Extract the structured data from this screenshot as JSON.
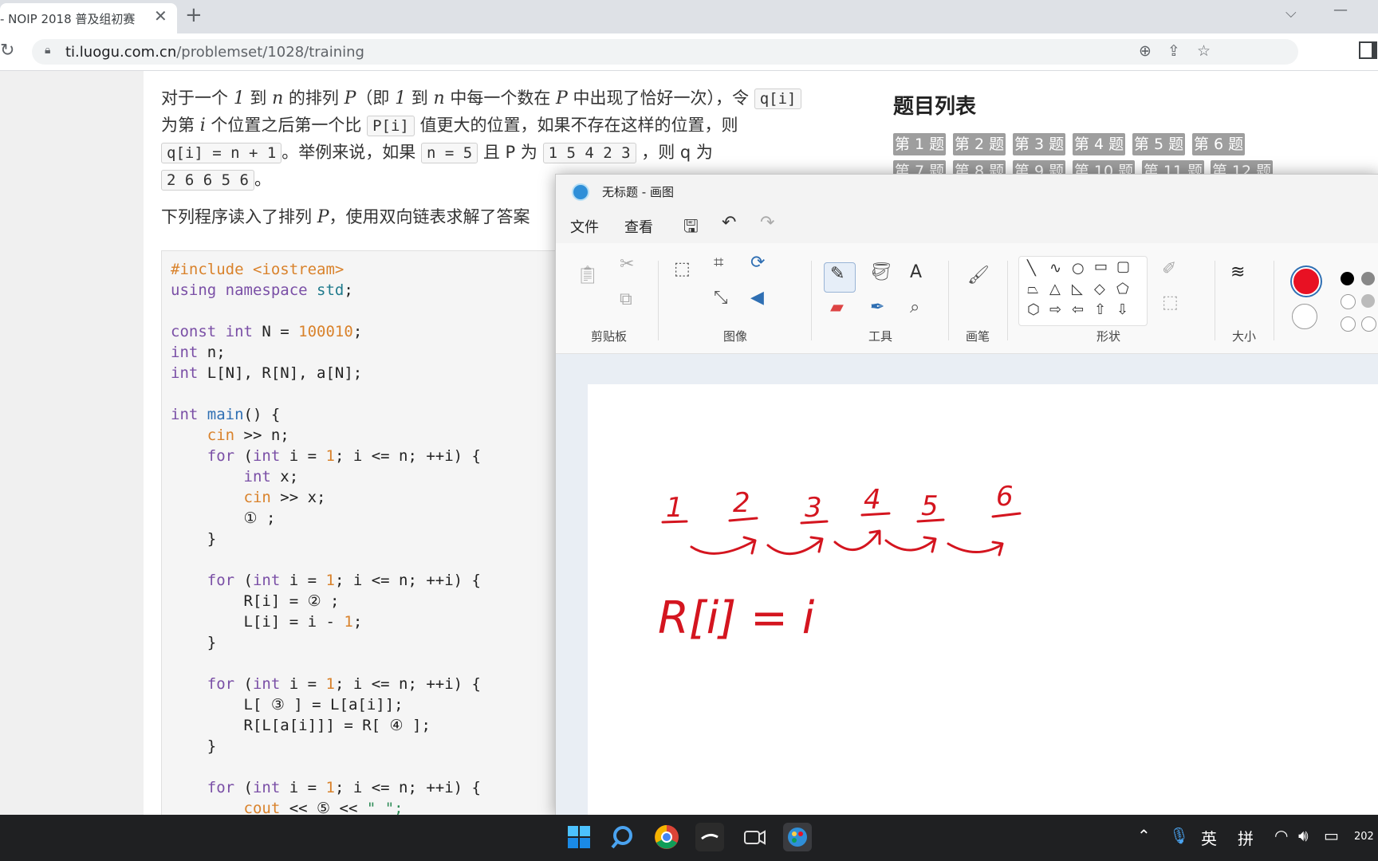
{
  "browser": {
    "tab_title": "- NOIP 2018 普及组初赛",
    "url_domain": "ti.luogu.com.cn",
    "url_path": "/problemset/1028/training"
  },
  "problem": {
    "p1a": "对于一个",
    "p1b": "1",
    "p1c": "到",
    "p1d": "n",
    "p1e": "的排列",
    "p1f": "P",
    "p1g": "（即",
    "p1h": "1",
    "p1i": "到",
    "p1j": "n",
    "p1k": "中每一个数在",
    "p1l": "P",
    "p1m": "中出现了恰好一次），令",
    "c_qi": "q[i]",
    "p2a": "为第",
    "p2b": "i",
    "p2c": "个位置之后第一个比",
    "c_pi": "P[i]",
    "p2d": "值更大的位置，如果不存在这样的位置，则",
    "c_qn": "q[i] = n + 1",
    "p3a": "。举例来说，如果",
    "c_n5": "n = 5",
    "p3b": "且 P 为",
    "c_p": "1 5 4 2 3",
    "p3c": "，则 q 为",
    "c_q": "2 6 6 5 6",
    "p4": "。",
    "p5a": "下列程序读入了排列",
    "p5b": "P",
    "p5c": "，使用双向链表求解了答案"
  },
  "code": {
    "l1": "#include <iostream>",
    "l2a": "using namespace",
    "l2b": "std",
    "l3a": "const int",
    "l3b": "N = ",
    "l3c": "100010",
    "l4a": "int",
    "l4b": "n;",
    "l5a": "int",
    "l5b": "L[N], R[N], a[N];",
    "l6a": "int",
    "l6b": "main",
    "l6c": "() {",
    "l7a": "cin",
    "l7b": ">> n;",
    "for_kw": "for",
    "int_kw": "int",
    "one": "1",
    "loop_mid": "; i <= n; ++i) {",
    "l9b": "x;",
    "l10b": ">> x;",
    "l11": "① ;",
    "l13": "R[i] = ② ;",
    "l14a": "L[i] = i - ",
    "l15": "}",
    "l17": "L[ ③ ] = L[a[i]];",
    "l18": "R[L[a[i]]] = R[ ④ ];",
    "l20a": "cout",
    "l20b": "<< ⑤ <<",
    "l20c": "\" \";"
  },
  "right_panel": {
    "title": "题目列表",
    "questions": [
      "第 1 题",
      "第 2 题",
      "第 3 题",
      "第 4 题",
      "第 5 题",
      "第 6 题"
    ],
    "questions_row2": [
      "第 7 题",
      "第 8 题",
      "第 9 题",
      "第 10 题",
      "第 11 题",
      "第 12 题"
    ]
  },
  "paint": {
    "title": "无标题 - 画图",
    "menu_file": "文件",
    "menu_view": "查看",
    "groups": {
      "clipboard": "剪贴板",
      "image": "图像",
      "tools": "工具",
      "brushes": "画笔",
      "shapes": "形状",
      "size": "大小"
    },
    "primary_color": "#e81123",
    "drawing": {
      "numbers": [
        "1",
        "2",
        "3",
        "4",
        "5",
        "6"
      ],
      "formula": "R[i] = i"
    }
  },
  "taskbar": {
    "ime_lang": "英",
    "ime_mode": "拼",
    "clock": "202"
  }
}
